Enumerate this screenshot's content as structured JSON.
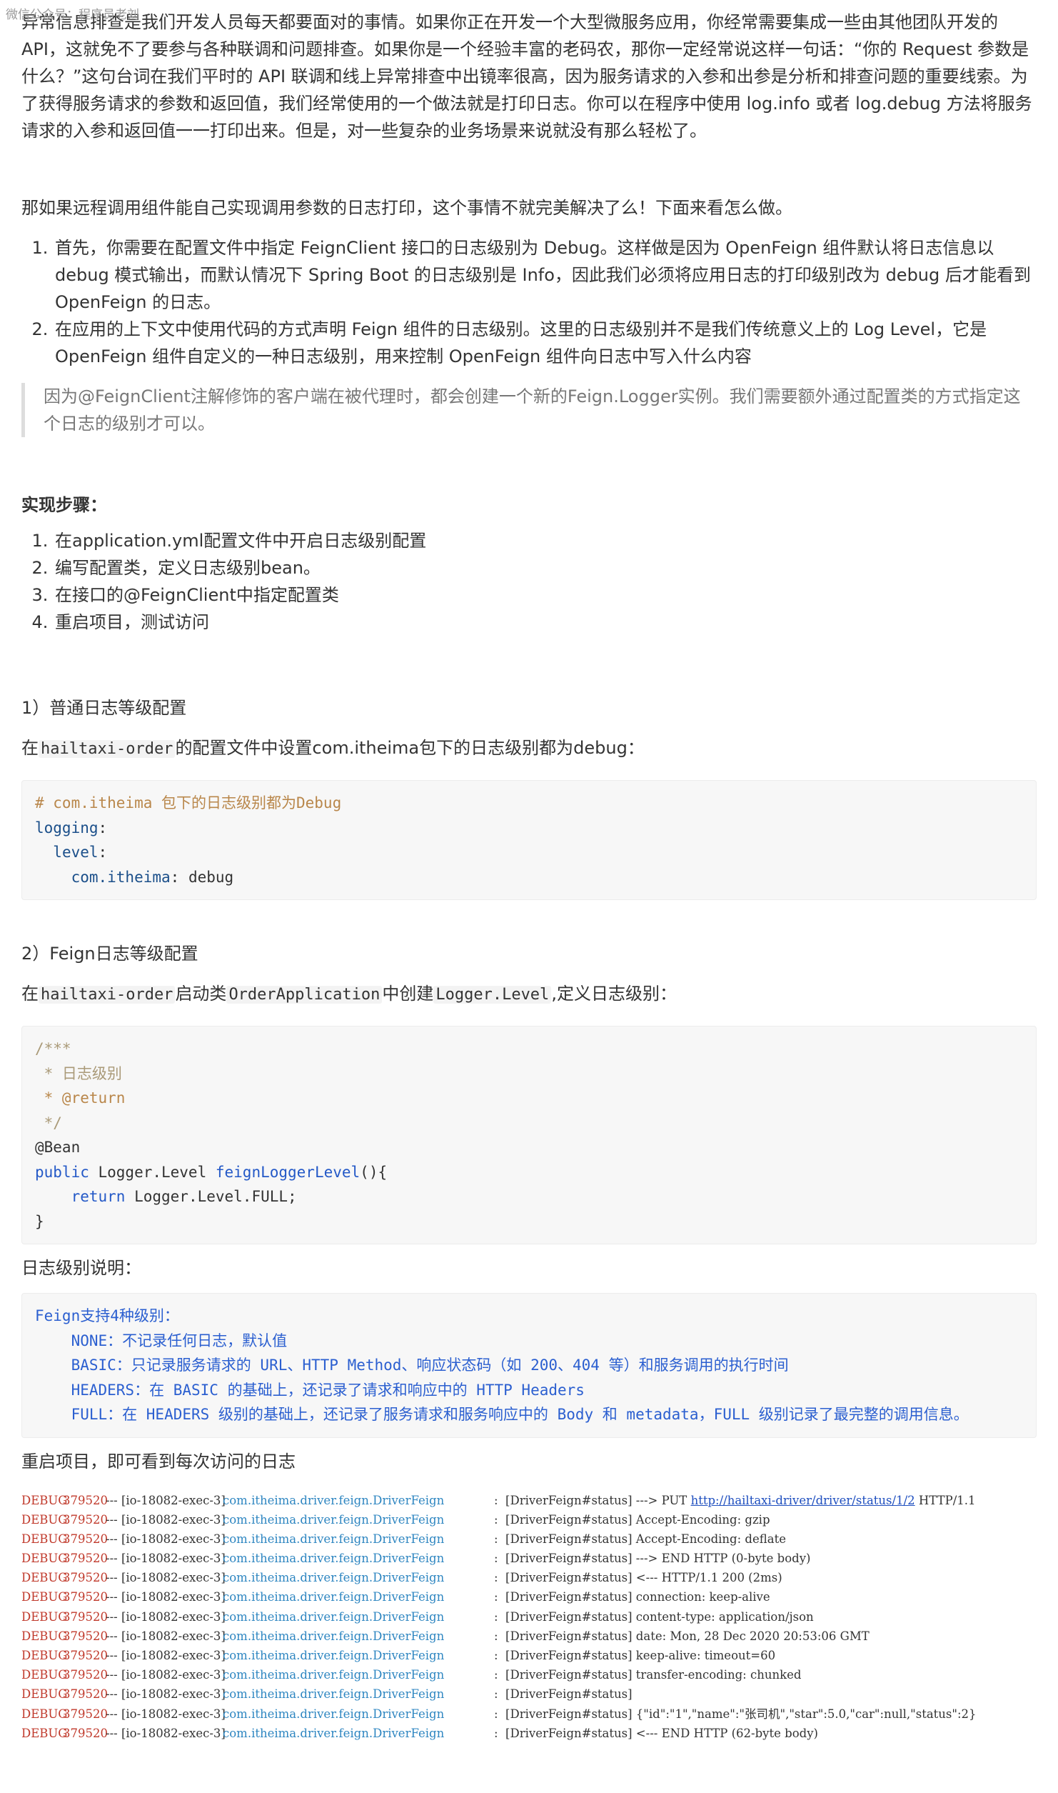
{
  "watermark": "微信公众号：程序员老刘",
  "intro": {
    "para1": "异常信息排查是我们开发人员每天都要面对的事情。如果你正在开发一个大型微服务应用，你经常需要集成一些由其他团队开发的 API，这就免不了要参与各种联调和问题排查。如果你是一个经验丰富的老码农，那你一定经常说这样一句话：“你的 Request 参数是什么？”这句台词在我们平时的 API 联调和线上异常排查中出镜率很高，因为服务请求的入参和出参是分析和排查问题的重要线索。为了获得服务请求的参数和返回值，我们经常使用的一个做法就是打印日志。你可以在程序中使用 log.info 或者 log.debug 方法将服务请求的入参和返回值一一打印出来。但是，对一些复杂的业务场景来说就没有那么轻松了。",
    "para2": "那如果远程调用组件能自己实现调用参数的日志打印，这个事情不就完美解决了么！下面来看怎么做。"
  },
  "steps_intro": [
    "首先，你需要在配置文件中指定 FeignClient 接口的日志级别为 Debug。这样做是因为 OpenFeign 组件默认将日志信息以 debug 模式输出，而默认情况下 Spring Boot 的日志级别是 Info，因此我们必须将应用日志的打印级别改为 debug 后才能看到 OpenFeign 的日志。",
    "在应用的上下文中使用代码的方式声明 Feign 组件的日志级别。这里的日志级别并不是我们传统意义上的 Log Level，它是 OpenFeign 组件自定义的一种日志级别，用来控制 OpenFeign 组件向日志中写入什么内容"
  ],
  "quote": "因为@FeignClient注解修饰的客户端在被代理时，都会创建一个新的Feign.Logger实例。我们需要额外通过配置类的方式指定这个日志的级别才可以。",
  "impl_title": "实现步骤：",
  "impl_steps": [
    "在application.yml配置文件中开启日志级别配置",
    "编写配置类，定义日志级别bean。",
    "在接口的@FeignClient中指定配置类",
    "重启项目，测试访问"
  ],
  "section1": {
    "title": "1）普通日志等级配置",
    "desc_before": "在",
    "desc_code": "hailtaxi-order",
    "desc_after": "的配置文件中设置com.itheima包下的日志级别都为debug：",
    "code": {
      "comment": "# com.itheima 包下的日志级别都为Debug",
      "l1": "logging",
      "l2": "level",
      "l3_key": "com.itheima",
      "l3_val": "debug"
    }
  },
  "section2": {
    "title": "2）Feign日志等级配置",
    "desc_1": "在",
    "desc_code1": "hailtaxi-order",
    "desc_2": "启动类",
    "desc_code2": "OrderApplication",
    "desc_3": "中创建",
    "desc_code3": "Logger.Level",
    "desc_4": ",定义日志级别：",
    "code": {
      "c1": "/***",
      "c2": " * 日志级别",
      "c3": " * @return",
      "c4": " */",
      "ann": "@Bean",
      "sig_kw": "public",
      "sig_type": " Logger.Level ",
      "sig_fn": "feignLoggerLevel",
      "sig_end": "(){",
      "ret_kw": "    return",
      "ret_val": " Logger.Level.FULL;",
      "close": "}"
    }
  },
  "levels_title": "日志级别说明：",
  "levels": {
    "head": "Feign支持4种级别：",
    "none": "    NONE：不记录任何日志，默认值",
    "basic": "    BASIC：只记录服务请求的 URL、HTTP Method、响应状态码（如 200、404 等）和服务调用的执行时间",
    "headers": "    HEADERS：在 BASIC 的基础上，还记录了请求和响应中的 HTTP Headers",
    "full": "    FULL：在 HEADERS 级别的基础上，还记录了服务请求和服务响应中的 Body 和 metadata，FULL 级别记录了最完整的调用信息。"
  },
  "restart_text": "重启项目，即可看到每次访问的日志",
  "log": {
    "level": "DEBUG",
    "pid": "379520",
    "sep": " --- ",
    "thread": "[io-18082-exec-3]",
    "cls": "com.itheima.driver.feign.DriverFeign",
    "colon": "  : ",
    "rows": [
      "[DriverFeign#status] ---> PUT ",
      "[DriverFeign#status] Accept-Encoding: gzip",
      "[DriverFeign#status] Accept-Encoding: deflate",
      "[DriverFeign#status] ---> END HTTP (0-byte body)",
      "[DriverFeign#status] <--- HTTP/1.1 200 (2ms)",
      "[DriverFeign#status] connection: keep-alive",
      "[DriverFeign#status] content-type: application/json",
      "[DriverFeign#status] date: Mon, 28 Dec 2020 20:53:06 GMT",
      "[DriverFeign#status] keep-alive: timeout=60",
      "[DriverFeign#status] transfer-encoding: chunked",
      "[DriverFeign#status]",
      "[DriverFeign#status] {\"id\":\"1\",\"name\":\"张司机\",\"star\":5.0,\"car\":null,\"status\":2}",
      "[DriverFeign#status] <--- END HTTP (62-byte body)"
    ],
    "url": "http://hailtaxi-driver/driver/status/1/2",
    "url_suffix": " HTTP/1.1"
  }
}
